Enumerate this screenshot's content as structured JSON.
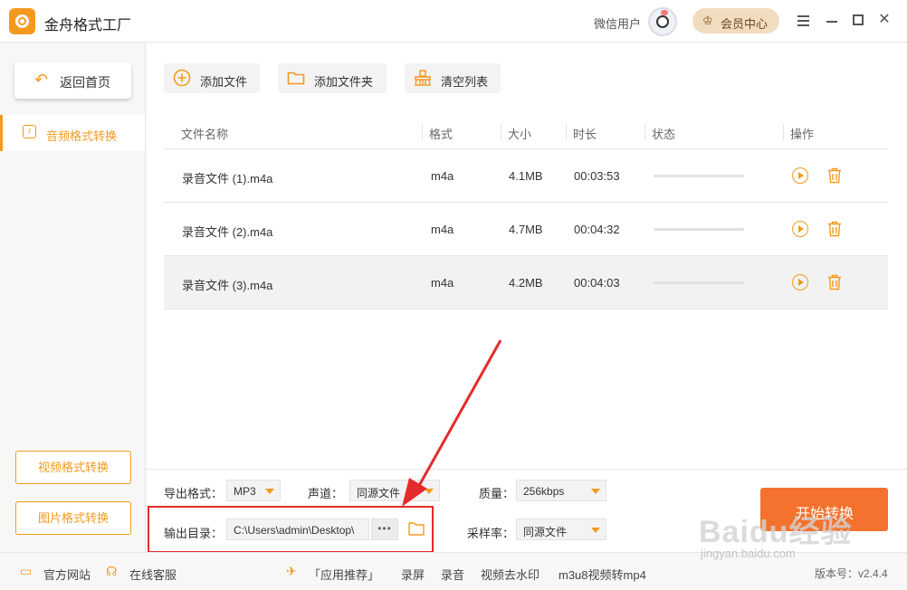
{
  "app": {
    "title": "金舟格式工厂",
    "accent": "#f39a1e"
  },
  "header": {
    "user_name": "微信用户",
    "vip_label": "会员中心"
  },
  "sidebar": {
    "back_label": "返回首页",
    "active_item": "音频格式转换",
    "video_btn": "视频格式转换",
    "image_btn": "图片格式转换"
  },
  "toolbar": {
    "add_file": "添加文件",
    "add_folder": "添加文件夹",
    "clear_list": "清空列表"
  },
  "table": {
    "headers": [
      "文件名称",
      "格式",
      "大小",
      "时长",
      "状态",
      "操作"
    ],
    "rows": [
      {
        "name": "录音文件 (1).m4a",
        "format": "m4a",
        "size": "4.1MB",
        "duration": "00:03:53"
      },
      {
        "name": "录音文件 (2).m4a",
        "format": "m4a",
        "size": "4.7MB",
        "duration": "00:04:32"
      },
      {
        "name": "录音文件 (3).m4a",
        "format": "m4a",
        "size": "4.2MB",
        "duration": "00:04:03"
      }
    ]
  },
  "settings": {
    "export_format_label": "导出格式：",
    "export_format_value": "MP3",
    "channel_label": "声道：",
    "channel_value": "同源文件",
    "quality_label": "质量：",
    "quality_value": "256kbps",
    "output_dir_label": "输出目录：",
    "output_dir_value": "C:\\Users\\admin\\Desktop\\",
    "sample_rate_label": "采样率：",
    "sample_rate_value": "同源文件",
    "start_label": "开始转换"
  },
  "footer": {
    "official_site": "官方网站",
    "online_service": "在线客服",
    "app_recommend": "「应用推荐」",
    "record_screen": "录屏",
    "record_audio": "录音",
    "video_watermark": "视频去水印",
    "m3u8": "m3u8视频转mp4",
    "version": "版本号：v2.4.4"
  },
  "watermark": {
    "big": "Baidu经验",
    "small": "jingyan.baidu.com"
  }
}
